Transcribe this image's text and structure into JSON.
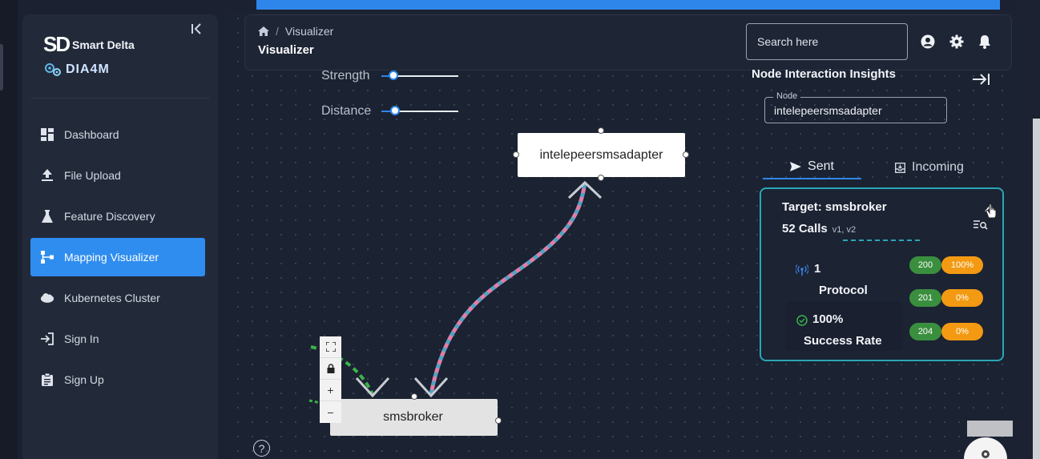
{
  "brand": {
    "logo": "SD",
    "name": "Smart Delta",
    "sub": "DIA4M"
  },
  "sidebar": {
    "collapse_icon": "collapse-left-icon",
    "items": [
      {
        "label": "Dashboard",
        "icon": "dashboard-icon",
        "active": false
      },
      {
        "label": "File Upload",
        "icon": "upload-icon",
        "active": false
      },
      {
        "label": "Feature Discovery",
        "icon": "flask-icon",
        "active": false
      },
      {
        "label": "Mapping Visualizer",
        "icon": "flow-icon",
        "active": true
      },
      {
        "label": "Kubernetes Cluster",
        "icon": "cloud-icon",
        "active": false
      },
      {
        "label": "Sign In",
        "icon": "login-icon",
        "active": false
      },
      {
        "label": "Sign Up",
        "icon": "clipboard-icon",
        "active": false
      }
    ]
  },
  "header": {
    "breadcrumb": [
      "Visualizer"
    ],
    "title": "Visualizer",
    "search_placeholder": "Search here"
  },
  "controls": {
    "strength_label": "Strength",
    "distance_label": "Distance",
    "strength_value": 0.2,
    "distance_value": 0.2
  },
  "graph": {
    "source_node": "intelepeersmsadapter",
    "target_node": "smsbroker"
  },
  "insights": {
    "title": "Node Interaction Insights",
    "node_label": "Node",
    "node_value": "intelepeersmsadapter",
    "tabs": {
      "sent": "Sent",
      "incoming": "Incoming"
    },
    "card": {
      "target": "Target: smsbroker",
      "calls": "52 Calls",
      "versions": "v1, v2",
      "protocol_count": "1",
      "protocol_label": "Protocol",
      "success_rate": "100%",
      "success_label": "Success Rate",
      "status_codes": [
        {
          "code": "200",
          "pct": "100%"
        },
        {
          "code": "201",
          "pct": "0%"
        },
        {
          "code": "204",
          "pct": "0%"
        }
      ]
    }
  },
  "colors": {
    "accent": "#2f86ea",
    "card_border": "#2aa6b7",
    "code_green": "#3a8f3e",
    "pct_orange": "#f39a12"
  }
}
